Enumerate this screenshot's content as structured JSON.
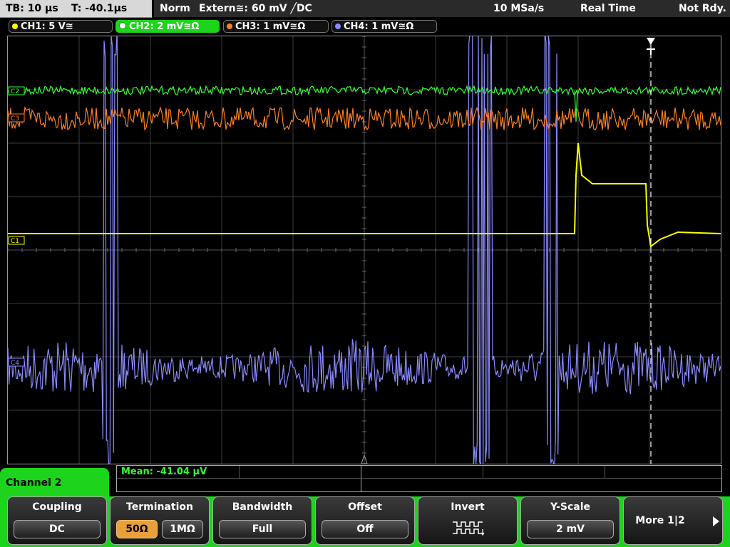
{
  "timebase": {
    "tb": "TB: 10 µs",
    "t": "T: -40.1µs"
  },
  "status": {
    "mode": "Norm",
    "trigger": "Extern≅: 60 mV ╱DC",
    "sample_rate": "10 MSa/s",
    "acq_mode": "Real Time",
    "state": "Not Rdy."
  },
  "channels": [
    {
      "label": "CH1: 5 V≅",
      "color": "#ffff00"
    },
    {
      "label": "CH2: 2 mV≅Ω",
      "color": "#33ff33",
      "active": true
    },
    {
      "label": "CH3: 1 mV≅Ω",
      "color": "#ff7f24"
    },
    {
      "label": "CH4: 1 mV≅Ω",
      "color": "#8a8aff"
    }
  ],
  "markers": {
    "ch1": "C1",
    "ch2": "C2",
    "ch3": "C3",
    "ch4": "C4"
  },
  "measurement": {
    "text": "Mean: -41.04 µV",
    "color": "#33ff33"
  },
  "menu": {
    "title": "Channel 2",
    "softkeys": [
      {
        "title": "Coupling",
        "value": "DC"
      },
      {
        "title": "Termination",
        "options": [
          "50Ω",
          "1MΩ"
        ],
        "selected": 0
      },
      {
        "title": "Bandwidth",
        "value": "Full"
      },
      {
        "title": "Offset",
        "value": "Off"
      },
      {
        "title": "Invert",
        "icon": "inverted-square-wave-icon"
      },
      {
        "title": "Y-Scale",
        "value": "2 mV"
      },
      {
        "title": "More 1|2",
        "icon": "arrow-right-icon"
      }
    ]
  }
}
